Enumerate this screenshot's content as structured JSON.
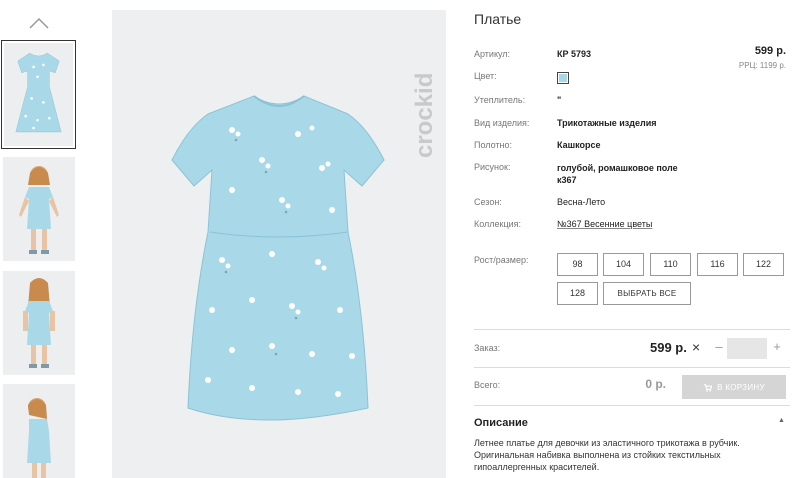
{
  "product": {
    "title": "Платье",
    "price": "599 р.",
    "rrp": "РРЦ: 1199 р."
  },
  "details": [
    {
      "label": "Артикул:",
      "value": "КР 5793"
    },
    {
      "label": "Цвет:",
      "value": ""
    },
    {
      "label": "Утеплитель:",
      "value": "\""
    },
    {
      "label": "Вид изделия:",
      "value": "Трикотажные изделия"
    },
    {
      "label": "Полотно:",
      "value": "Кашкорсе"
    },
    {
      "label": "Рисунок:",
      "value": "голубой, ромашковое поле\nк367"
    },
    {
      "label": "Сезон:",
      "value": "Весна-Лето"
    },
    {
      "label": "Коллекция:",
      "value": "№367 Весенние цветы"
    }
  ],
  "color_swatch_hex": "#a6d8ea",
  "sizes": {
    "label": "Рост/размер:",
    "options": [
      "98",
      "104",
      "110",
      "116",
      "122",
      "128"
    ],
    "select_all": "ВЫБРАТЬ ВСЕ"
  },
  "order": {
    "label": "Заказ:",
    "price": "599 р.",
    "multiply": "×",
    "minus": "–",
    "plus": "+",
    "quantity": ""
  },
  "total": {
    "label": "Всего:",
    "value": "0 р.",
    "cart_button": "В КОРЗИНУ"
  },
  "description": {
    "heading": "Описание",
    "caret": "▲",
    "text": "Летнее платье для девочки из эластичного трикотажа в рубчик. Оригинальная набивка выполнена из стойких текстильных гипоаллергенных красителей."
  },
  "brand": {
    "logo_text": "crockid"
  },
  "icons": {
    "thumbs_up": "chevron-up-icon",
    "cart": "cart-icon"
  },
  "colors": {
    "dress": "#a9d9e8",
    "background": "#edeff1",
    "cart_button_disabled": "#d5d5d5"
  }
}
